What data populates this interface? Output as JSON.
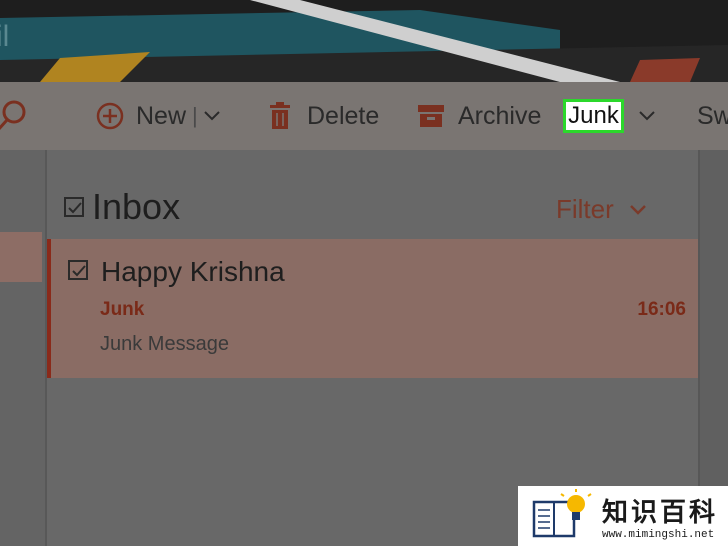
{
  "header": {
    "app_title_fragment": "il"
  },
  "toolbar": {
    "new_label": "New",
    "separator": "|",
    "delete_label": "Delete",
    "archive_label": "Archive",
    "junk_label": "Junk",
    "sweep_label": "Sw"
  },
  "mail": {
    "folder_title": "Inbox",
    "filter_label": "Filter",
    "messages": [
      {
        "sender": "Happy Krishna",
        "folder": "Junk",
        "time": "16:06",
        "preview": "Junk Message"
      }
    ]
  },
  "watermark": {
    "title": "知识百科",
    "url": "www.mimingshi.net"
  },
  "colors": {
    "accent": "#c0462a",
    "highlight_border": "#2bd82b",
    "selected_row": "#8a6c64"
  },
  "icons": [
    "search-icon",
    "plus-circle-icon",
    "chevron-down-icon",
    "trash-icon",
    "archive-icon",
    "checkbox-icon",
    "book-lightbulb-icon"
  ]
}
